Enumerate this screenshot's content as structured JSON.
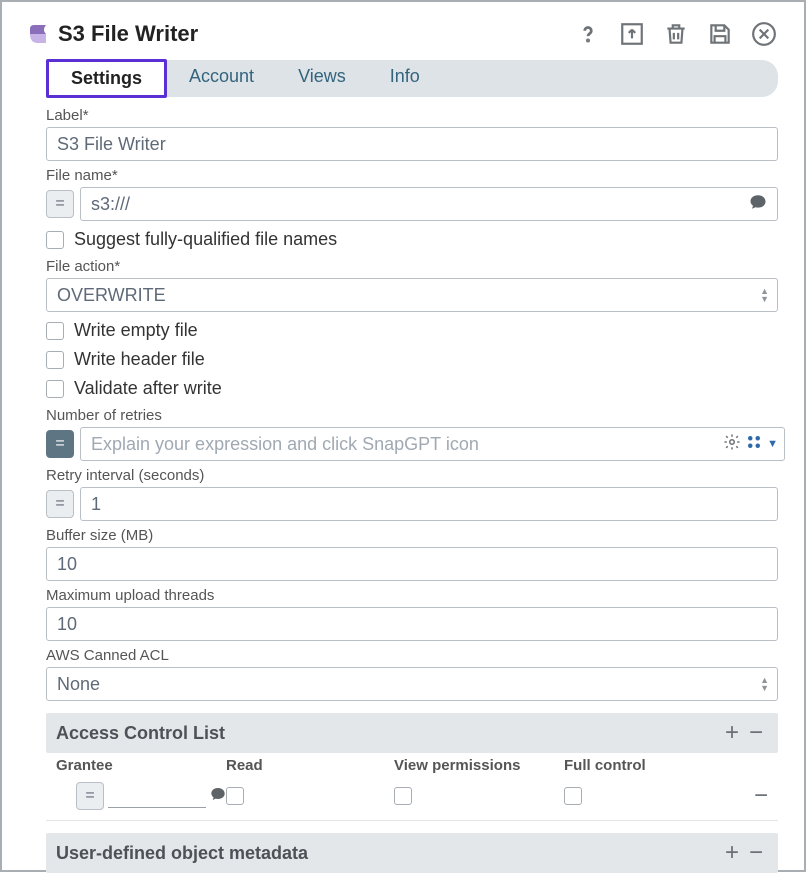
{
  "header": {
    "title": "S3 File Writer"
  },
  "tabs": {
    "items": [
      "Settings",
      "Account",
      "Views",
      "Info"
    ],
    "active_index": 0
  },
  "form": {
    "label_field": {
      "label": "Label*",
      "value": "S3 File Writer"
    },
    "filename_field": {
      "label": "File name*",
      "value": "s3:///"
    },
    "suggest_fqfn": {
      "label": "Suggest fully-qualified file names",
      "checked": false
    },
    "file_action": {
      "label": "File action*",
      "value": "OVERWRITE"
    },
    "write_empty": {
      "label": "Write empty file",
      "checked": false
    },
    "write_header": {
      "label": "Write header file",
      "checked": false
    },
    "validate_after": {
      "label": "Validate after write",
      "checked": false
    },
    "retries": {
      "label": "Number of retries",
      "placeholder": "Explain your expression and click SnapGPT icon",
      "value": ""
    },
    "retry_interval": {
      "label": "Retry interval (seconds)",
      "value": "1"
    },
    "buffer_size": {
      "label": "Buffer size (MB)",
      "value": "10"
    },
    "max_threads": {
      "label": "Maximum upload threads",
      "value": "10"
    },
    "canned_acl": {
      "label": "AWS Canned ACL",
      "value": "None"
    }
  },
  "acl": {
    "title": "Access Control List",
    "columns": [
      "Grantee",
      "Read",
      "View permissions",
      "Full control"
    ],
    "rows": [
      {
        "grantee": "",
        "read": false,
        "view": false,
        "full": false
      }
    ]
  },
  "metadata": {
    "title": "User-defined object metadata"
  }
}
